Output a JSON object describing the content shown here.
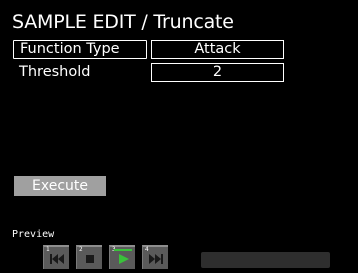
{
  "header": {
    "title": "SAMPLE EDIT / Truncate"
  },
  "params": [
    {
      "label": "Function Type",
      "value": "Attack"
    },
    {
      "label": "Threshold",
      "value": "2"
    }
  ],
  "execute_label": "Execute",
  "preview": {
    "label": "Preview",
    "buttons": [
      {
        "num": "1",
        "icon": "rewind-icon"
      },
      {
        "num": "2",
        "icon": "stop-icon"
      },
      {
        "num": "3",
        "icon": "play-icon"
      },
      {
        "num": "4",
        "icon": "fast-forward-icon"
      }
    ]
  },
  "colors": {
    "accent_green": "#39c13a",
    "button_gray": "#a0a0a0"
  }
}
